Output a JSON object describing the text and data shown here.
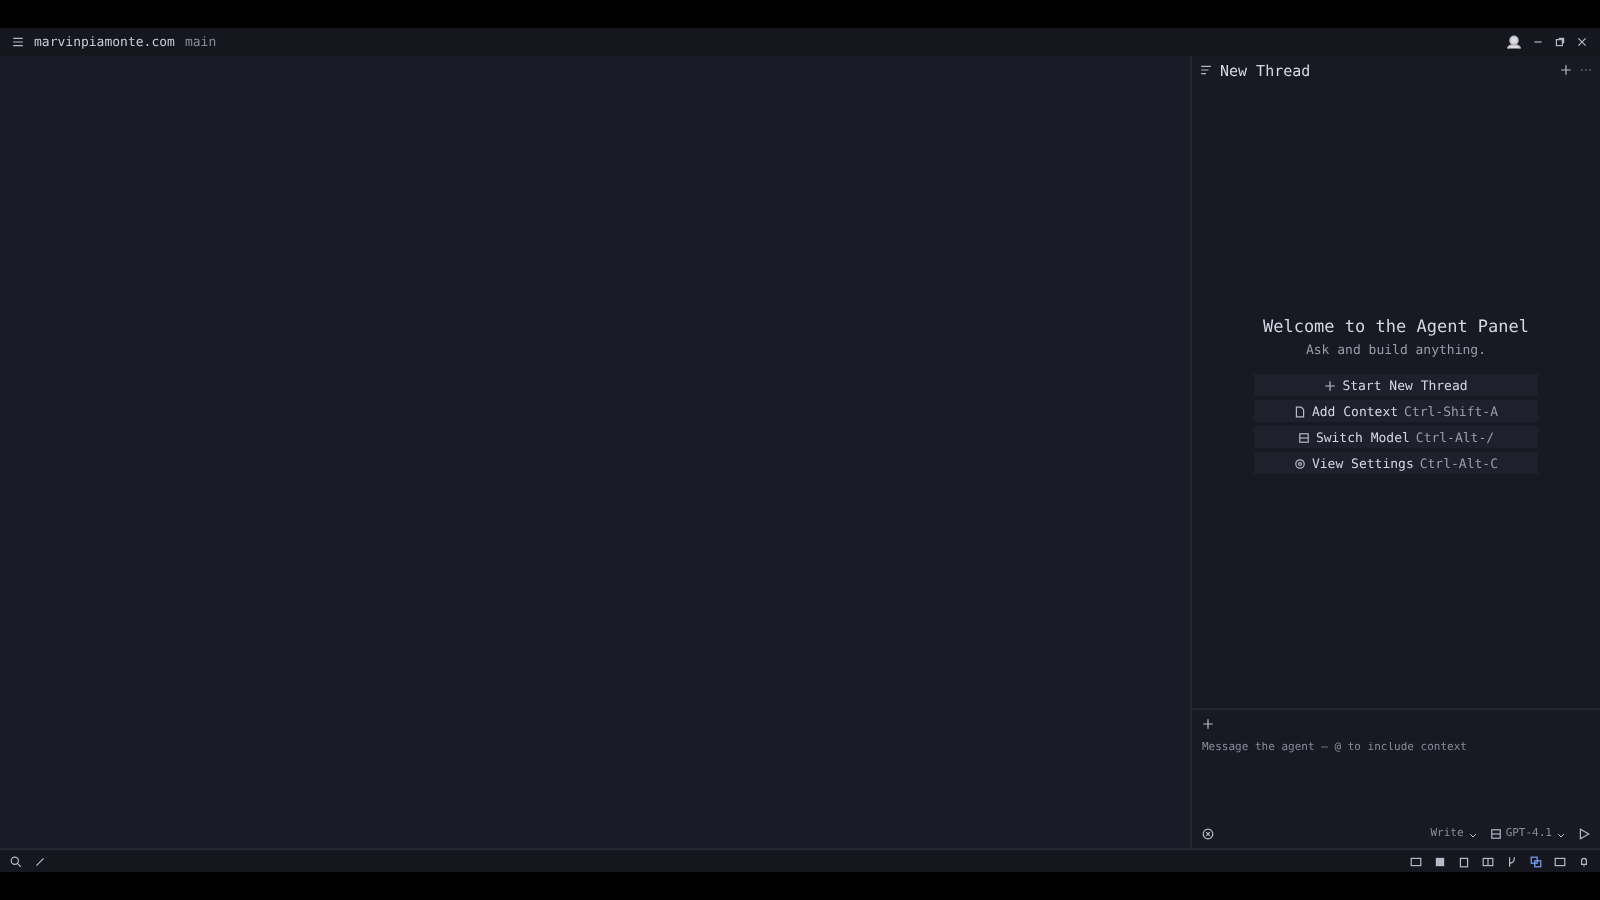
{
  "titlebar": {
    "project": "marvinpiamonte.com",
    "branch": "main"
  },
  "agent_panel": {
    "title": "New Thread",
    "welcome_title": "Welcome to the Agent Panel",
    "welcome_subtitle": "Ask and build anything.",
    "actions": [
      {
        "kind": "plus",
        "label": "Start New Thread"
      },
      {
        "kind": "file",
        "label": "Add Context",
        "shortcut": "Ctrl-Shift-A"
      },
      {
        "kind": "model",
        "label": "Switch Model",
        "shortcut": "Ctrl-Alt-/"
      },
      {
        "kind": "settings",
        "label": "View Settings",
        "shortcut": "Ctrl-Alt-C"
      }
    ],
    "message_placeholder": "Message the agent – @ to include context",
    "mode": "Write",
    "model": "GPT-4.1"
  }
}
